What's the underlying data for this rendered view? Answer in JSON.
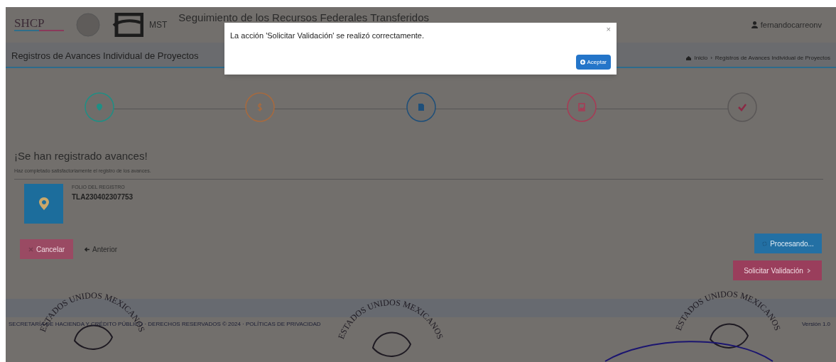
{
  "header": {
    "logo_text": "SHCP",
    "logo2_text": "MST",
    "title": "Seguimiento de los Recursos Federales Transferidos",
    "user": "fernandocarreonv"
  },
  "title_bar": {
    "title": "Registros de Avances Individual de Proyectos",
    "breadcrumb": [
      "Inicio",
      "Registros de Avances Individual de Proyectos"
    ],
    "separator": "›"
  },
  "steps": [
    {
      "kind": "pin",
      "color": "#1f8f85"
    },
    {
      "kind": "dollar",
      "color": "#a86a3e"
    },
    {
      "kind": "file",
      "color": "#1e4f7a"
    },
    {
      "kind": "image",
      "color": "#a83a55"
    },
    {
      "kind": "check",
      "color": "#5a5757"
    }
  ],
  "result": {
    "heading": "¡Se han registrado avances!",
    "message": "Haz completado satisfactoriamente el registro de los avances.",
    "folio_label": "FOLIO DEL REGISTRO",
    "folio": "TLA230402307753"
  },
  "buttons": [
    {
      "label": "Cancelar",
      "kind": "cancel"
    },
    {
      "label": "Anterior",
      "kind": "back"
    },
    {
      "label": "Procesando...",
      "kind": "processing"
    },
    {
      "label": "Solicitar Validación",
      "kind": "next"
    }
  ],
  "footer": {
    "text": "SECRETARÍA DE HACIENDA Y CRÉDITO PÚBLICO · DERECHOS RESERVADOS © 2024 · POLÍTICAS DE PRIVACIDAD",
    "version": "Versión 1.0"
  },
  "stamps": [
    {
      "text": "ESTADOS UNIDOS MEXICANOS"
    },
    {
      "text": "ESTADOS UNIDOS MEXICANOS"
    },
    {
      "text": "ESTADOS UNIDOS MEXICANOS"
    }
  ],
  "modal": {
    "message": "La acción 'Solicitar Validación' se realizó correctamente.",
    "close": "×",
    "button": "Aceptar"
  }
}
